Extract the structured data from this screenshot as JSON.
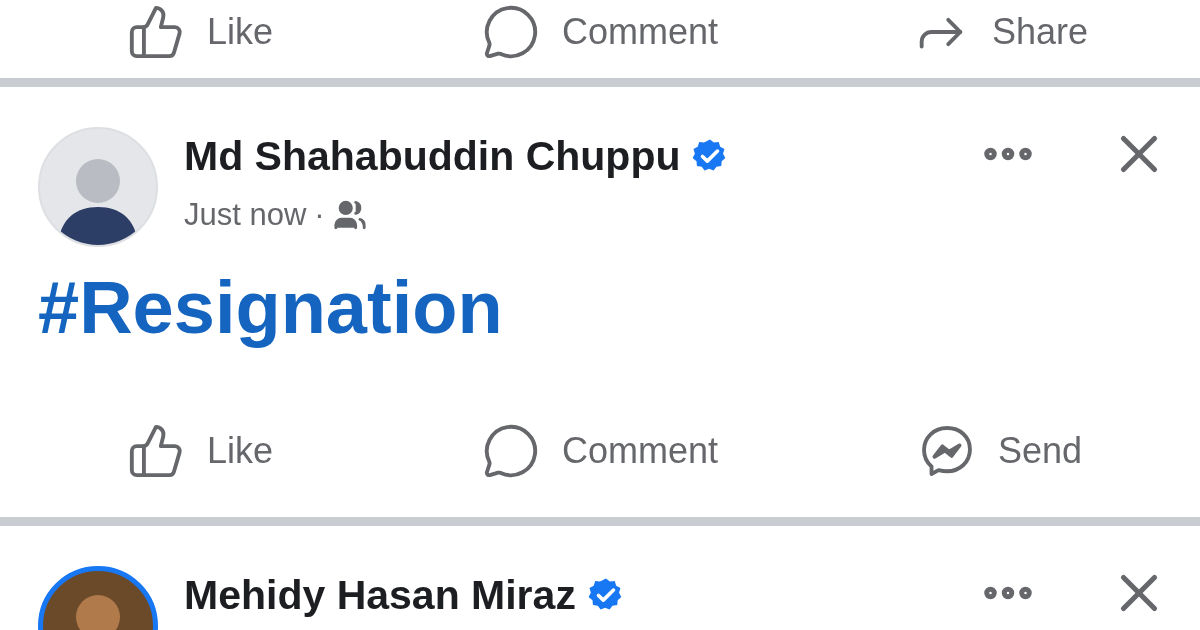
{
  "posts": [
    {
      "kind": "actions_only",
      "actions": [
        {
          "kind": "like",
          "label": "Like"
        },
        {
          "kind": "comment",
          "label": "Comment"
        },
        {
          "kind": "share",
          "label": "Share"
        }
      ]
    },
    {
      "kind": "full",
      "author": "Md Shahabuddin Chuppu",
      "verified": true,
      "has_story": false,
      "time": "Just now",
      "separator": "·",
      "text": "#Resignation",
      "actions": [
        {
          "kind": "like",
          "label": "Like"
        },
        {
          "kind": "comment",
          "label": "Comment"
        },
        {
          "kind": "send",
          "label": "Send"
        }
      ]
    },
    {
      "kind": "header_only",
      "author": "Mehidy Hasan Miraz",
      "verified": true,
      "has_story": true
    }
  ]
}
